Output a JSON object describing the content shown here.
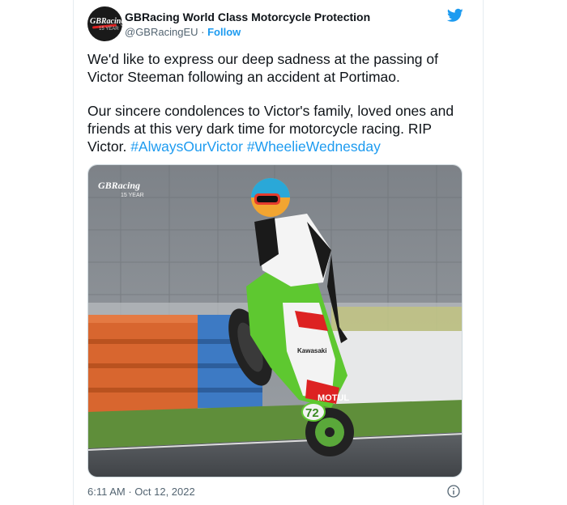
{
  "account": {
    "name": "GBRacing World Class Motorcycle Protection",
    "handle": "@GBRacingEU",
    "separator": "·",
    "follow_label": "Follow",
    "avatar_logo_text": "GBRacing",
    "avatar_logo_sub": "15 YEAR"
  },
  "tweet": {
    "paragraph1": "We'd like to express our deep sadness at the passing of Victor Steeman following an accident at Portimao.",
    "paragraph2_text": "Our sincere condolences to Victor's family, loved ones and friends at this very dark time for motorcycle racing. RIP Victor. ",
    "hashtag1": "#AlwaysOurVictor",
    "hashtag2": "#WheelieWednesday"
  },
  "media": {
    "watermark": "GBRacing",
    "watermark_sub": "15 YEAR",
    "bike_number": "72",
    "bike_sponsor": "MOTUL",
    "bike_brand": "Kawasaki"
  },
  "footer": {
    "timestamp": "6:11 AM · Oct 12, 2022"
  },
  "icons": {
    "brand": "twitter-bird-icon",
    "info": "info-icon"
  },
  "colors": {
    "accent": "#1d9bf0",
    "text": "#0f1419",
    "muted": "#536471"
  }
}
